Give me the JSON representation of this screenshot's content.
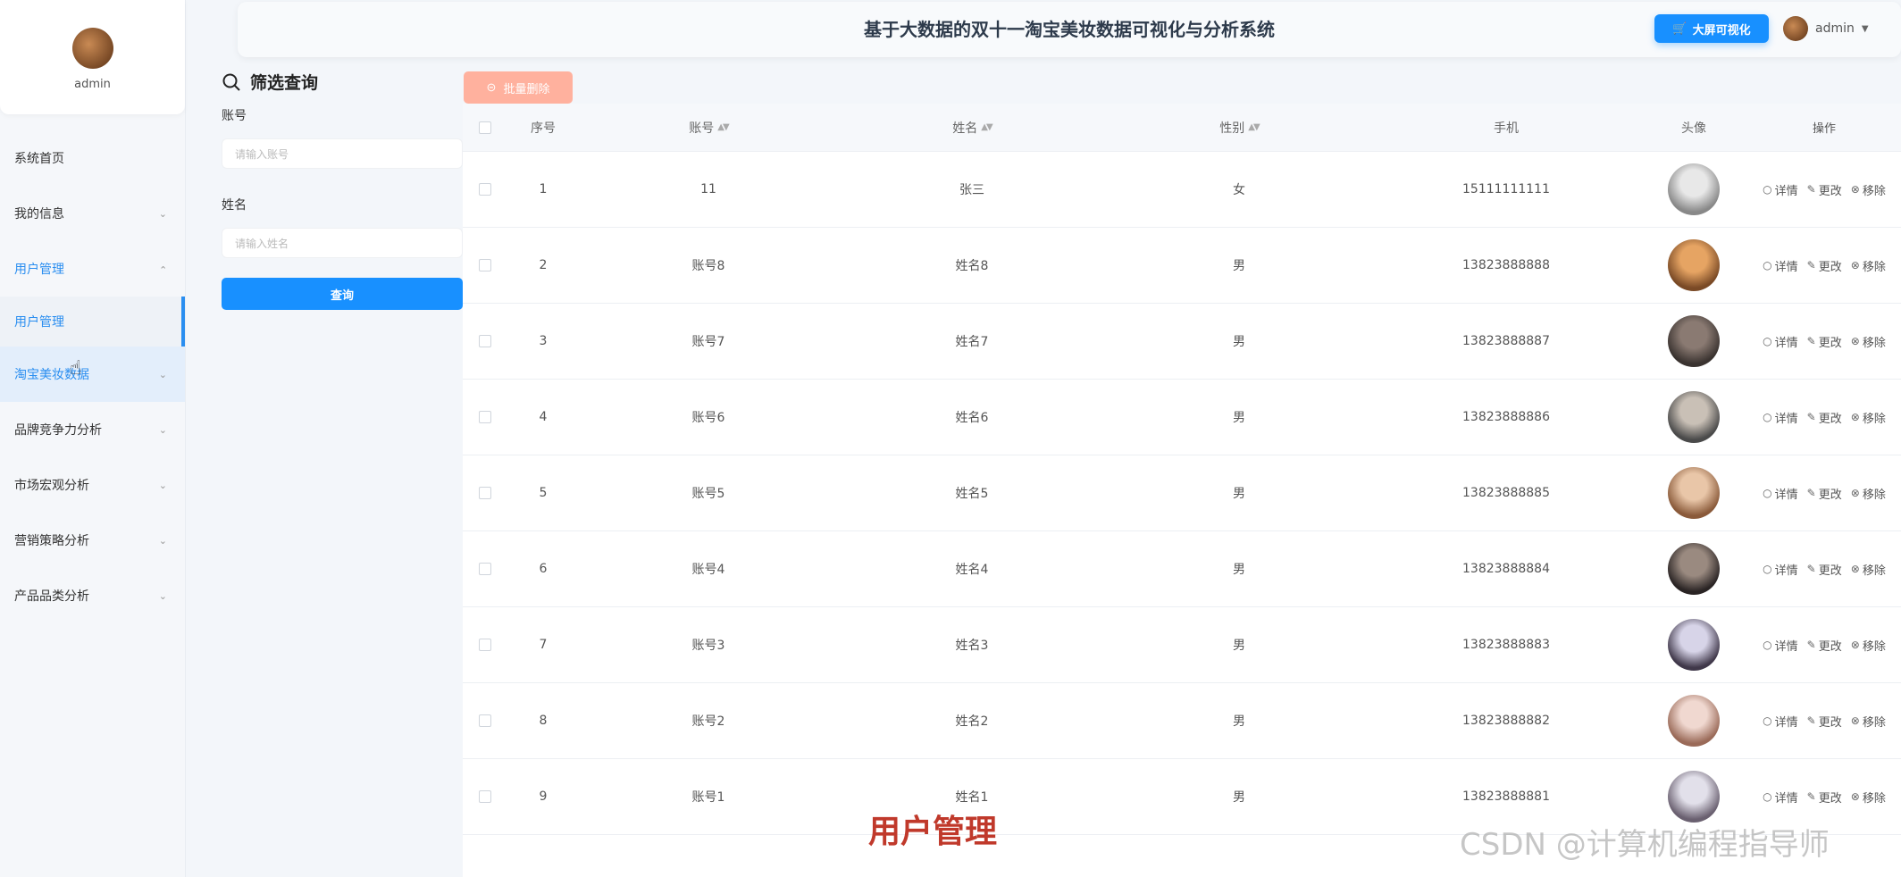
{
  "header": {
    "title": "基于大数据的双十一淘宝美妆数据可视化与分析系统",
    "screen_button": "大屏可视化",
    "username": "admin"
  },
  "sidebar": {
    "username": "admin",
    "items": [
      {
        "label": "系统首页"
      },
      {
        "label": "我的信息"
      },
      {
        "label": "用户管理"
      },
      {
        "label": "用户管理"
      },
      {
        "label": "淘宝美妆数据"
      },
      {
        "label": "品牌竞争力分析"
      },
      {
        "label": "市场宏观分析"
      },
      {
        "label": "营销策略分析"
      },
      {
        "label": "产品品类分析"
      }
    ]
  },
  "filter": {
    "title": "筛选查询",
    "account_label": "账号",
    "account_placeholder": "请输入账号",
    "name_label": "姓名",
    "name_placeholder": "请输入姓名",
    "query_button": "查询"
  },
  "toolbar": {
    "batch_delete": "批量删除"
  },
  "table": {
    "headers": {
      "index": "序号",
      "account": "账号",
      "name": "姓名",
      "gender": "性别",
      "phone": "手机",
      "avatar": "头像",
      "ops": "操作"
    },
    "ops": {
      "detail": "详情",
      "edit": "更改",
      "remove": "移除"
    },
    "rows": [
      {
        "index": "1",
        "account": "11",
        "name": "张三",
        "gender": "女",
        "phone": "15111111111"
      },
      {
        "index": "2",
        "account": "账号8",
        "name": "姓名8",
        "gender": "男",
        "phone": "13823888888"
      },
      {
        "index": "3",
        "account": "账号7",
        "name": "姓名7",
        "gender": "男",
        "phone": "13823888887"
      },
      {
        "index": "4",
        "account": "账号6",
        "name": "姓名6",
        "gender": "男",
        "phone": "13823888886"
      },
      {
        "index": "5",
        "account": "账号5",
        "name": "姓名5",
        "gender": "男",
        "phone": "13823888885"
      },
      {
        "index": "6",
        "account": "账号4",
        "name": "姓名4",
        "gender": "男",
        "phone": "13823888884"
      },
      {
        "index": "7",
        "account": "账号3",
        "name": "姓名3",
        "gender": "男",
        "phone": "13823888883"
      },
      {
        "index": "8",
        "account": "账号2",
        "name": "姓名2",
        "gender": "男",
        "phone": "13823888882"
      },
      {
        "index": "9",
        "account": "账号1",
        "name": "姓名1",
        "gender": "男",
        "phone": "13823888881"
      }
    ]
  },
  "overlay": {
    "caption": "用户管理",
    "watermark": "CSDN @计算机编程指导师"
  },
  "colors": {
    "primary": "#1890ff",
    "batch_delete": "#ffb19e",
    "caption": "#c0392b"
  }
}
